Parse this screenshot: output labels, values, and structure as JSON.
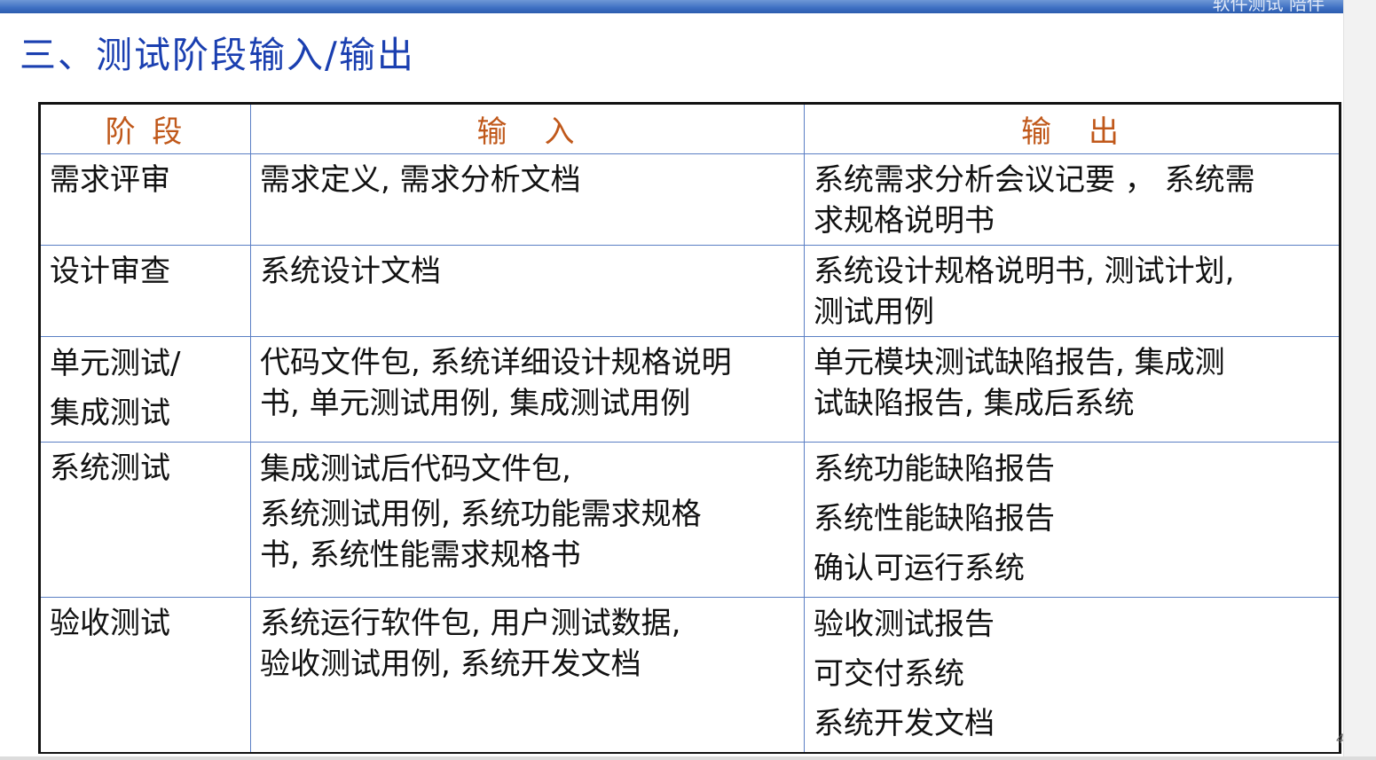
{
  "header": {
    "banner_text": "软件测试 陪伴"
  },
  "page_title": "三、测试阶段输入/输出",
  "table": {
    "headers": [
      "阶 段",
      "输　入",
      "输　出"
    ],
    "rows": [
      {
        "stage": [
          "需求评审"
        ],
        "input": [
          "需求定义, 需求分析文档"
        ],
        "output": [
          "系统需求分析会议记要 ，  系统需",
          "求规格说明书"
        ]
      },
      {
        "stage": [
          "设计审查"
        ],
        "input": [
          "系统设计文档"
        ],
        "output": [
          "系统设计规格说明书, 测试计划,",
          "测试用例"
        ]
      },
      {
        "stage": [
          "单元测试/",
          "集成测试"
        ],
        "input": [
          "代码文件包, 系统详细设计规格说明",
          "书, 单元测试用例, 集成测试用例"
        ],
        "output": [
          "单元模块测试缺陷报告, 集成测",
          "试缺陷报告, 集成后系统"
        ]
      },
      {
        "stage": [
          "系统测试"
        ],
        "input": [
          "集成测试后代码文件包,",
          "系统测试用例, 系统功能需求规格",
          "书, 系统性能需求规格书"
        ],
        "output": [
          "系统功能缺陷报告",
          "系统性能缺陷报告",
          "确认可运行系统"
        ]
      },
      {
        "stage": [
          "验收测试"
        ],
        "input": [
          "系统运行软件包, 用户测试数据,",
          "验收测试用例, 系统开发文档"
        ],
        "output": [
          "验收测试报告",
          "可交付系统",
          "系统开发文档"
        ]
      }
    ]
  },
  "page_number": "4"
}
